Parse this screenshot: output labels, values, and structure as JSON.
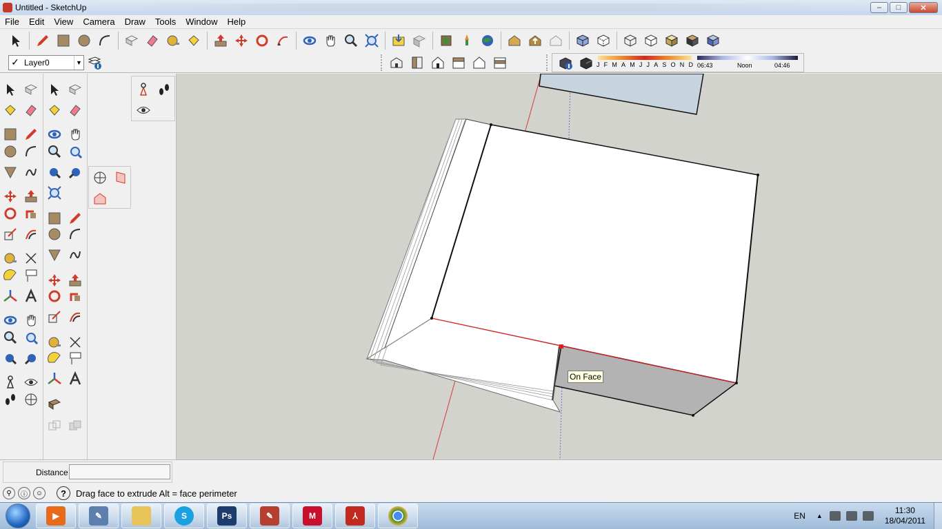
{
  "window": {
    "title": "Untitled - SketchUp",
    "minimize": "–",
    "maximize": "□",
    "close": "✕"
  },
  "menu": [
    "File",
    "Edit",
    "View",
    "Camera",
    "Draw",
    "Tools",
    "Window",
    "Help"
  ],
  "layer": {
    "checkmark": "✓",
    "current": "Layer0",
    "arrow": "▼"
  },
  "shadows": {
    "months": [
      "J",
      "F",
      "M",
      "A",
      "M",
      "J",
      "J",
      "A",
      "S",
      "O",
      "N",
      "D"
    ],
    "time_start": "06:43",
    "time_mid": "Noon",
    "time_end": "04:46"
  },
  "viewport": {
    "tooltip": "On Face",
    "background": "#d3d3cd",
    "red_axis": "#d43a3a",
    "blue_axis": "#5a74c9"
  },
  "measurements": {
    "label": "Distance",
    "value": ""
  },
  "status": {
    "help": "?",
    "message": "Drag face to extrude  Alt = face perimeter"
  },
  "taskbar": {
    "language": "EN",
    "time": "11:30",
    "date": "18/04/2011",
    "apps": [
      {
        "name": "windows-media-player",
        "label": "",
        "color": "#e86b1c"
      },
      {
        "name": "sketch-tool",
        "label": "",
        "color": "#5c7fae"
      },
      {
        "name": "explorer",
        "label": "",
        "color": "#e8c458"
      },
      {
        "name": "skype",
        "label": "",
        "color": "#1ba1e2"
      },
      {
        "name": "photoshop",
        "label": "Ps",
        "color": "#1d3c6c"
      },
      {
        "name": "sketchup",
        "label": "",
        "color": "#b5402f"
      },
      {
        "name": "mcafee",
        "label": "M",
        "color": "#c8102e"
      },
      {
        "name": "acrobat",
        "label": "",
        "color": "#c22a1f"
      },
      {
        "name": "chrome",
        "label": "",
        "color": "#3d8e3a"
      }
    ]
  }
}
